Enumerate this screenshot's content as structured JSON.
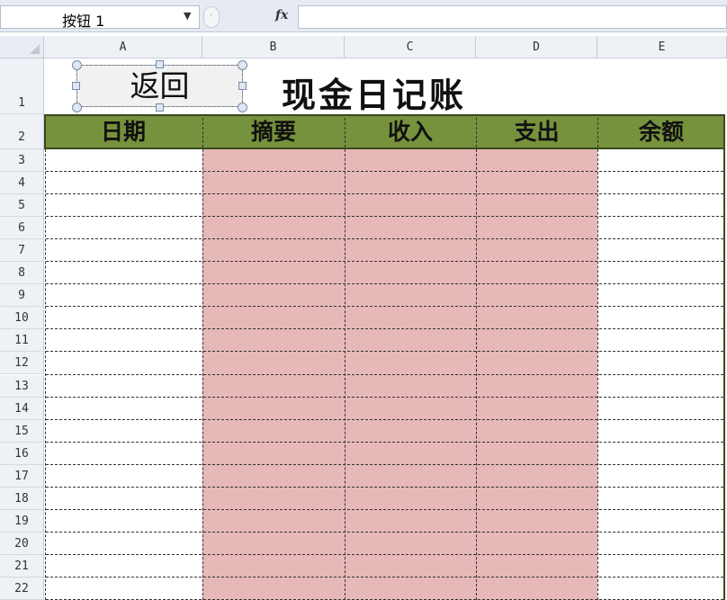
{
  "formula_bar": {
    "name_box": "按钮 1",
    "fx_label": "fx",
    "formula_value": ""
  },
  "columns": [
    "A",
    "B",
    "C",
    "D",
    "E"
  ],
  "rows": [
    "1",
    "2",
    "3",
    "4",
    "5",
    "6",
    "7",
    "8",
    "9",
    "10",
    "11",
    "12",
    "13",
    "14",
    "15",
    "16",
    "17",
    "18",
    "19",
    "20",
    "21",
    "22"
  ],
  "sheet": {
    "title": "现金日记账",
    "button_label": "返回",
    "headers": [
      "日期",
      "摘要",
      "收入",
      "支出",
      "余额"
    ]
  },
  "colors": {
    "header_fill": "#76923c",
    "pink_fill": "#e6b8b7"
  }
}
